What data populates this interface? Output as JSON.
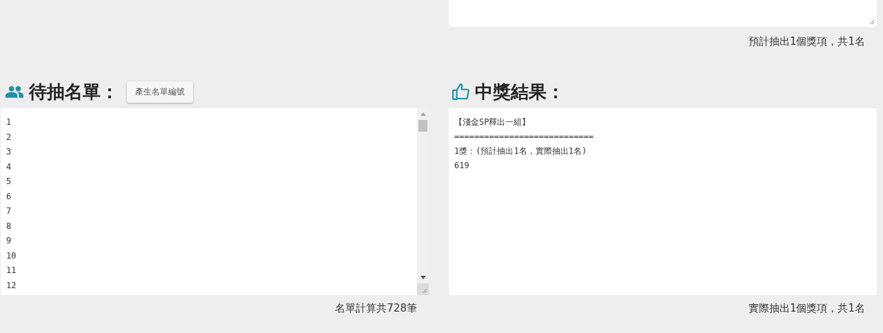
{
  "top_result": {
    "summary": "預計抽出1個獎項，共1名"
  },
  "candidates": {
    "title": "待抽名單：",
    "button": "產生名單編號",
    "lines": [
      "1",
      "2",
      "3",
      "4",
      "5",
      "6",
      "7",
      "8",
      "9",
      "10",
      "11",
      "12"
    ],
    "summary": "名單計算共728筆"
  },
  "results": {
    "title": "中獎結果：",
    "lines": [
      "【淺金SP釋出一組】",
      "============================",
      "1獎：(預計抽出1名，實際抽出1名)",
      "619"
    ],
    "summary": "實際抽出1個獎項，共1名"
  }
}
